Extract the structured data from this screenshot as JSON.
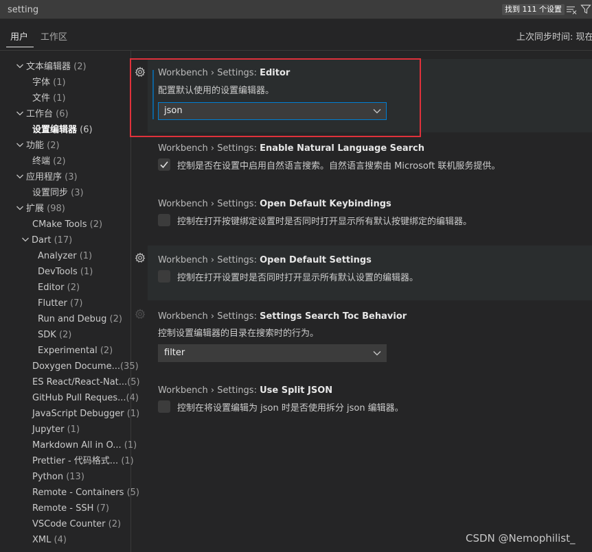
{
  "search": {
    "value": "setting",
    "result_count": "找到 111 个设置"
  },
  "icons": {
    "clear": "clear-filter-icon",
    "filter": "filter-icon",
    "gear": "gear-icon",
    "chevron": "chevron-down-icon",
    "check": "check-icon"
  },
  "tabs": {
    "user": "用户",
    "workspace": "工作区",
    "sync_status": "上次同步时间: 现在"
  },
  "toc": [
    {
      "label": "文本编辑器",
      "count": "(2)"
    },
    {
      "label": "字体",
      "count": "(1)"
    },
    {
      "label": "文件",
      "count": "(1)"
    },
    {
      "label": "工作台",
      "count": "(6)"
    },
    {
      "label": "设置编辑器",
      "count": "(6)"
    },
    {
      "label": "功能",
      "count": "(2)"
    },
    {
      "label": "终端",
      "count": "(2)"
    },
    {
      "label": "应用程序",
      "count": "(3)"
    },
    {
      "label": "设置同步",
      "count": "(3)"
    },
    {
      "label": "扩展",
      "count": "(98)"
    },
    {
      "label": "CMake Tools",
      "count": "(2)"
    },
    {
      "label": "Dart",
      "count": "(17)"
    },
    {
      "label": "Analyzer",
      "count": "(1)"
    },
    {
      "label": "DevTools",
      "count": "(1)"
    },
    {
      "label": "Editor",
      "count": "(2)"
    },
    {
      "label": "Flutter",
      "count": "(7)"
    },
    {
      "label": "Run and Debug",
      "count": "(2)"
    },
    {
      "label": "SDK",
      "count": "(2)"
    },
    {
      "label": "Experimental",
      "count": "(2)"
    },
    {
      "label": "Doxygen Docume...",
      "count": "(35)"
    },
    {
      "label": "ES React/React-Nat...",
      "count": "(5)"
    },
    {
      "label": "GitHub Pull Reques...",
      "count": "(4)"
    },
    {
      "label": "JavaScript Debugger",
      "count": "(1)"
    },
    {
      "label": "Jupyter",
      "count": "(1)"
    },
    {
      "label": "Markdown All in O...",
      "count": "(1)"
    },
    {
      "label": "Prettier - 代码格式...",
      "count": "(1)"
    },
    {
      "label": "Python",
      "count": "(13)"
    },
    {
      "label": "Remote - Containers",
      "count": "(5)"
    },
    {
      "label": "Remote - SSH",
      "count": "(7)"
    },
    {
      "label": "VSCode Counter",
      "count": "(2)"
    },
    {
      "label": "XML",
      "count": "(4)"
    }
  ],
  "settings": {
    "category": "Workbench › Settings: ",
    "editor": {
      "name": "Editor",
      "desc": "配置默认使用的设置编辑器。",
      "value": "json"
    },
    "nls": {
      "name": "Enable Natural Language Search",
      "desc": "控制是否在设置中启用自然语言搜索。自然语言搜索由 Microsoft 联机服务提供。",
      "checked": true
    },
    "keybindings": {
      "name": "Open Default Keybindings",
      "desc": "控制在打开按键绑定设置时是否同时打开显示所有默认按键绑定的编辑器。",
      "checked": false
    },
    "default_settings": {
      "name": "Open Default Settings",
      "desc": "控制在打开设置时是否同时打开显示所有默认设置的编辑器。",
      "checked": false
    },
    "toc_behavior": {
      "name": "Settings Search Toc Behavior",
      "desc": "控制设置编辑器的目录在搜索时的行为。",
      "value": "filter"
    },
    "split_json": {
      "name": "Use Split JSON",
      "desc": "控制在将设置编辑为 json 时是否使用拆分 json 编辑器。",
      "checked": false
    }
  },
  "watermark": "CSDN @Nemophilist_"
}
